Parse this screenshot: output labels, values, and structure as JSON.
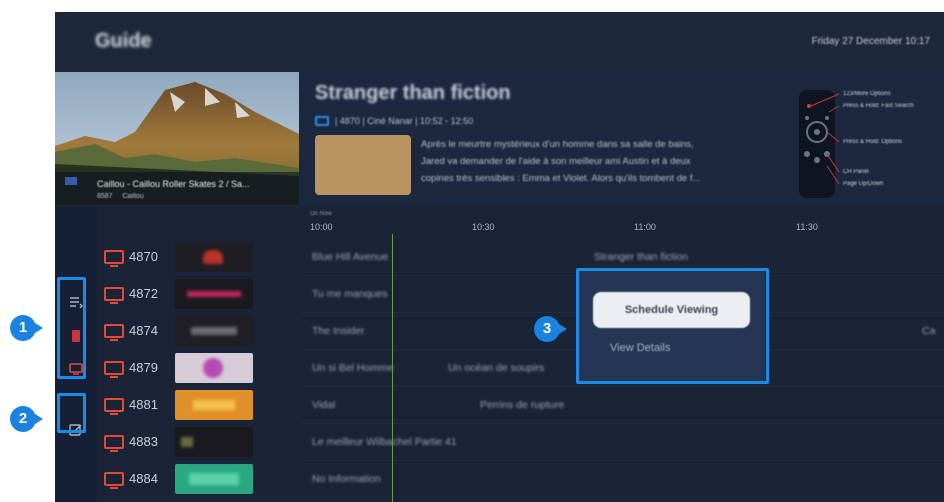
{
  "app": {
    "title": "Guide",
    "datetime": "Friday 27 December   10:17"
  },
  "preview": {
    "caption": "Caillou - Caillou Roller Skates 2 / Sa...",
    "sub": "Caillou",
    "channel_tag": "8587"
  },
  "program": {
    "title": "Stranger than fiction",
    "meta": "| 4870 | Ciné Nanar | 10:52 - 12:50",
    "desc_lines": [
      "Après le meurtre mystérieux d'un homme dans sa salle de bains,",
      "Jared va demander de l'aide à son meilleur ami Austin et à deux",
      "copines très sensibles : Emma et Violet. Alors qu'ils tombent de f..."
    ]
  },
  "remote_hints": [
    "123/More Options",
    "Press & Hold: Fast Search",
    "Press & Hold: Options",
    "CH Panel",
    "Page Up/Down"
  ],
  "timeline": {
    "now_label": "On Now",
    "ticks": [
      "10:00",
      "10:30",
      "11:00",
      "11:30"
    ]
  },
  "channels": [
    {
      "num": "4870",
      "logo_color": "#1e1e24",
      "logo_accent": "#b8332a"
    },
    {
      "num": "4872",
      "logo_color": "#1a1a1e",
      "logo_accent": "#c0275a"
    },
    {
      "num": "4874",
      "logo_color": "#202024",
      "logo_accent": "#6a6a70"
    },
    {
      "num": "4879",
      "logo_color": "#d6ccd8",
      "logo_accent": "#b64ab8"
    },
    {
      "num": "4881",
      "logo_color": "#e0902a",
      "logo_accent": "#f4c04a"
    },
    {
      "num": "4883",
      "logo_color": "#1a1a1e",
      "logo_accent": "#6a6a40"
    },
    {
      "num": "4884",
      "logo_color": "#2aa882",
      "logo_accent": "#5ad0a8"
    }
  ],
  "programs": [
    [
      "Blue Hill Avenue",
      "Stranger than fiction"
    ],
    [
      "Tu me manques"
    ],
    [
      "The Insider",
      "Ca"
    ],
    [
      "Un si Bel Homme",
      "Un océan de soupirs"
    ],
    [
      "Vidal",
      "Perrins de rupture"
    ],
    [
      "Le meilleur Wilbachel Partie 41"
    ],
    [
      "No Information"
    ]
  ],
  "context_menu": {
    "primary": "Schedule Viewing",
    "secondary": "View Details"
  },
  "callouts": [
    "1",
    "2",
    "3"
  ],
  "colors": {
    "highlight": "#1b8be8",
    "channel_icon": "#e24b3a",
    "now_line": "#6c9c38"
  }
}
